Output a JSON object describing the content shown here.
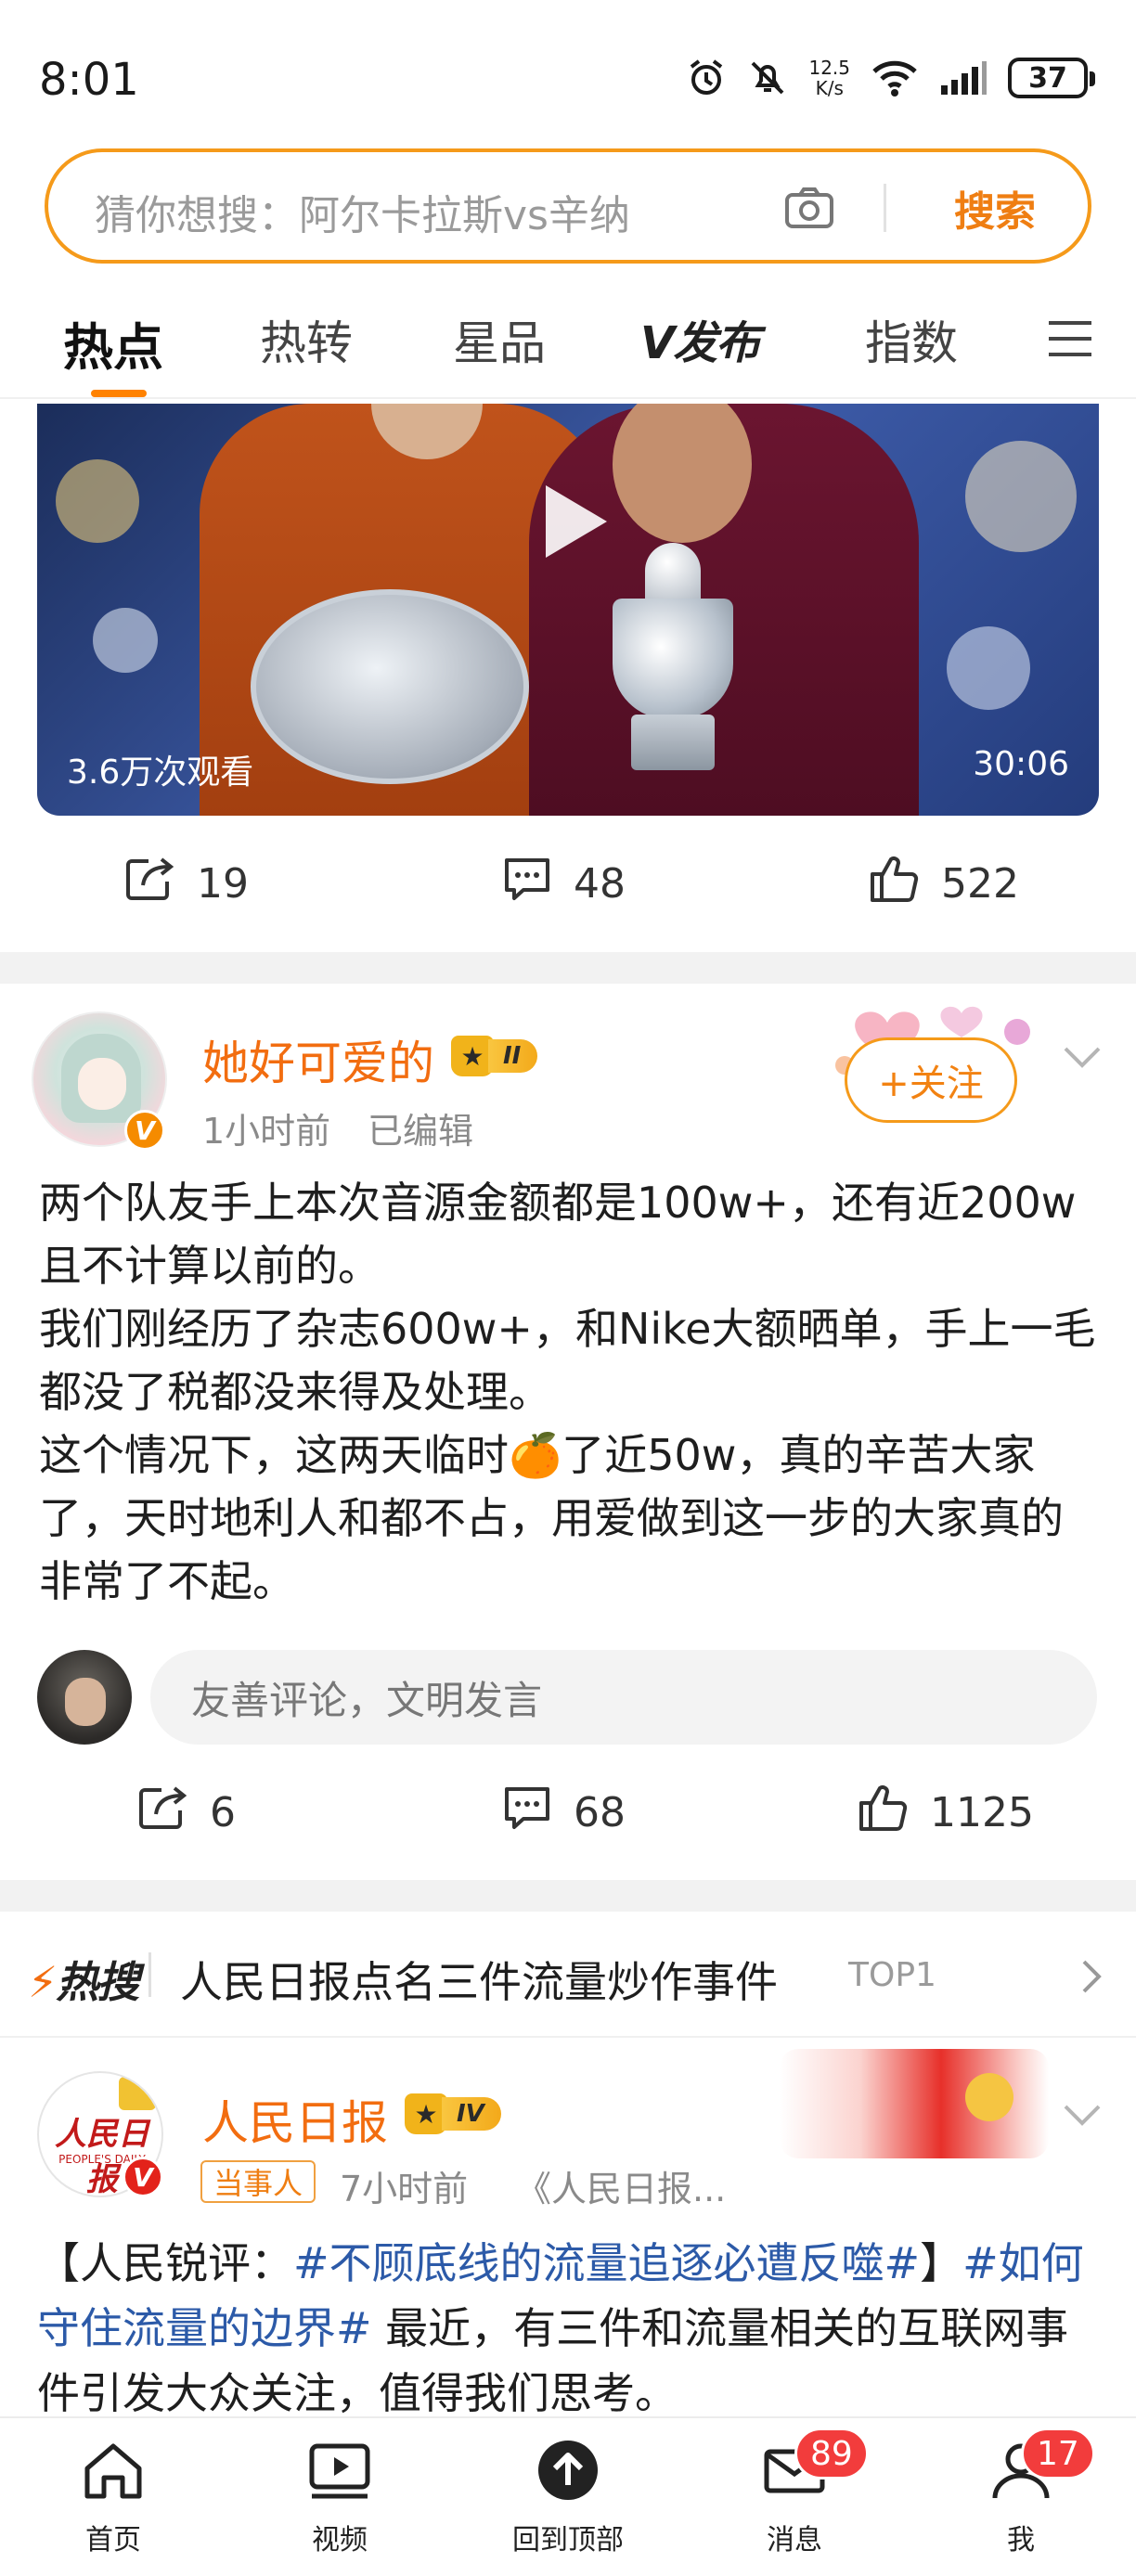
{
  "status_bar": {
    "time": "8:01",
    "net_speed_value": "12.5",
    "net_speed_unit": "K/s",
    "battery": "37",
    "icons": [
      "alarm-icon",
      "mute-icon",
      "wifi-icon",
      "signal-icon",
      "battery-icon"
    ]
  },
  "search": {
    "placeholder": "猜你想搜：阿尔卡拉斯vs辛纳",
    "button_label": "搜索"
  },
  "tabs": [
    {
      "label": "热点",
      "active": true
    },
    {
      "label": "热转",
      "active": false
    },
    {
      "label": "星品",
      "active": false
    },
    {
      "label": "V发布",
      "active": false
    },
    {
      "label": "指数",
      "active": false
    }
  ],
  "video": {
    "views": "3.6万次观看",
    "duration": "30:06"
  },
  "video_actions": {
    "repost": "19",
    "comments": "48",
    "likes": "522"
  },
  "post1": {
    "author": "她好可爱的",
    "level": "II",
    "time": "1小时前",
    "edited": "已编辑",
    "follow_label": "+关注",
    "lines": [
      "两个队友手上本次音源金额都是100w+，还有近200w且不计算以前的。",
      "我们刚经历了杂志600w+，和Nike大额晒单，手上一毛都没了税都没来得及处理。",
      "这个情况下，这两天临时🍊了近50w，真的辛苦大家了，天时地利人和都不占，用爱做到这一步的大家真的非常了不起。"
    ],
    "comment_placeholder": "友善评论，文明发言",
    "actions": {
      "repost": "6",
      "comments": "68",
      "likes": "1125"
    }
  },
  "hot_search": {
    "logo": "热搜",
    "title": "人民日报点名三件流量炒作事件",
    "rank": "TOP1"
  },
  "post2": {
    "author": "人民日报",
    "level": "IV",
    "tag": "当事人",
    "time": "7小时前",
    "source": "《人民日报...",
    "avatar_text": "人民日报",
    "avatar_subtext": "PEOPLE'S DAILY",
    "text_prefix": "【人民锐评：",
    "hashtag1": "#不顾底线的流量追逐必遭反噬#",
    "text_mid": "】",
    "hashtag2": "#如何守住流量的边界#",
    "text_suffix": " 最近，有三件和流量相关的互联网事件引发大众关注，值得我们思考。"
  },
  "bottom_nav": [
    {
      "label": "首页",
      "icon": "home-icon"
    },
    {
      "label": "视频",
      "icon": "video-icon"
    },
    {
      "label": "回到顶部",
      "icon": "back-to-top-icon"
    },
    {
      "label": "消息",
      "icon": "message-icon",
      "badge": "89"
    },
    {
      "label": "我",
      "icon": "profile-icon",
      "badge": "17"
    }
  ],
  "colors": {
    "accent": "#f59a1a",
    "name": "#f26d10",
    "hashtag": "#2c5aa8",
    "badge": "#f23c3c"
  }
}
